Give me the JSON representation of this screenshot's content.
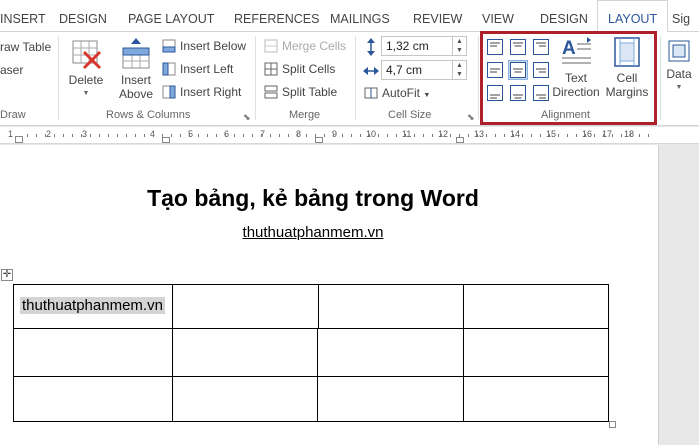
{
  "tabs": {
    "insert": "INSERT",
    "design": "DESIGN",
    "page_layout": "PAGE LAYOUT",
    "references": "REFERENCES",
    "mailings": "MAILINGS",
    "review": "REVIEW",
    "view": "VIEW",
    "table_design": "DESIGN",
    "layout": "LAYOUT",
    "sign": "Sig"
  },
  "ribbon": {
    "draw": {
      "draw_table": "raw Table",
      "eraser": "aser",
      "label": "Draw"
    },
    "rows_columns": {
      "delete": "Delete",
      "insert_above_1": "Insert",
      "insert_above_2": "Above",
      "insert_below": "Insert Below",
      "insert_left": "Insert Left",
      "insert_right": "Insert Right",
      "label": "Rows & Columns"
    },
    "merge": {
      "merge_cells": "Merge Cells",
      "split_cells": "Split Cells",
      "split_table": "Split Table",
      "label": "Merge"
    },
    "cell_size": {
      "height": "1,32 cm",
      "width": "4,7 cm",
      "autofit": "AutoFit",
      "label": "Cell Size"
    },
    "alignment": {
      "text_direction_1": "Text",
      "text_direction_2": "Direction",
      "cell_margins_1": "Cell",
      "cell_margins_2": "Margins",
      "label": "Alignment"
    },
    "data": {
      "label": "Data"
    }
  },
  "ruler": {
    "numbers": [
      "1",
      "2",
      "3",
      "4",
      "5",
      "6",
      "7",
      "8",
      "9",
      "10",
      "11",
      "12",
      "13",
      "14",
      "15",
      "16",
      "17",
      "18"
    ]
  },
  "document": {
    "title": "Tạo bảng, kẻ bảng trong Word",
    "subtitle": "thuthuatphanmem.vn",
    "table": {
      "cell_1_1": "thuthuatphanmem.vn"
    }
  },
  "colors": {
    "accent": "#2b579a",
    "highlight_border": "#b0202a",
    "selected_align": "#c5d9f1"
  }
}
